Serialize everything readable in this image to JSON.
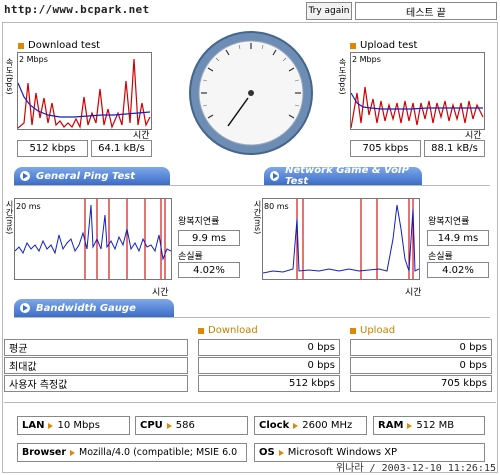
{
  "header": {
    "url": "http://www.bcpark.net",
    "try_again": "Try again",
    "end_test": "테스트 끝"
  },
  "download": {
    "title": "Download test",
    "scale": "2 Mbps",
    "unit": "속도(bps)",
    "time": "시간",
    "kbps": "512 kbps",
    "kBs": "64.1 kB/s"
  },
  "upload": {
    "title": "Upload test",
    "scale": "2 Mbps",
    "unit": "속도(bps)",
    "time": "시간",
    "kbps": "705 kbps",
    "kBs": "88.1 kB/s"
  },
  "ping": {
    "banner": "General Ping Test",
    "unit": "시간(ms)",
    "scale": "20 ms",
    "time": "시간",
    "rtt_label": "왕복지연률",
    "rtt": "9.9 ms",
    "loss_label": "손실률",
    "loss": "4.02%"
  },
  "game": {
    "banner": "Network Game & VoIP Test",
    "unit": "시간(ms)",
    "scale": "80 ms",
    "time": "시간",
    "rtt_label": "왕복지연률",
    "rtt": "14.9 ms",
    "loss_label": "손실률",
    "loss": "4.02%"
  },
  "gauge": {
    "banner": "Bandwidth Gauge",
    "download_head": "Download",
    "upload_head": "Upload",
    "rows": [
      {
        "label": "평균",
        "download": "0 bps",
        "upload": "0 bps"
      },
      {
        "label": "최대값",
        "download": "0 bps",
        "upload": "0 bps"
      },
      {
        "label": "사용자 측정값",
        "download": "512 kbps",
        "upload": "705 kbps"
      }
    ]
  },
  "system": {
    "lan_label": "LAN",
    "lan": "10 Mbps",
    "cpu_label": "CPU",
    "cpu": "586",
    "clock_label": "Clock",
    "clock": "2600 MHz",
    "ram_label": "RAM",
    "ram": "512 MB",
    "browser_label": "Browser",
    "browser": "Mozilla/4.0 (compatible; MSIE 6.0",
    "os_label": "OS",
    "os": "Microsoft Windows XP"
  },
  "footer": "위나라 / 2003-12-10 11:26:15",
  "colors": {
    "banner": "#3c6cc8",
    "accent": "#e08800",
    "red_line": "#d00000",
    "blue_line": "#1020c0"
  }
}
